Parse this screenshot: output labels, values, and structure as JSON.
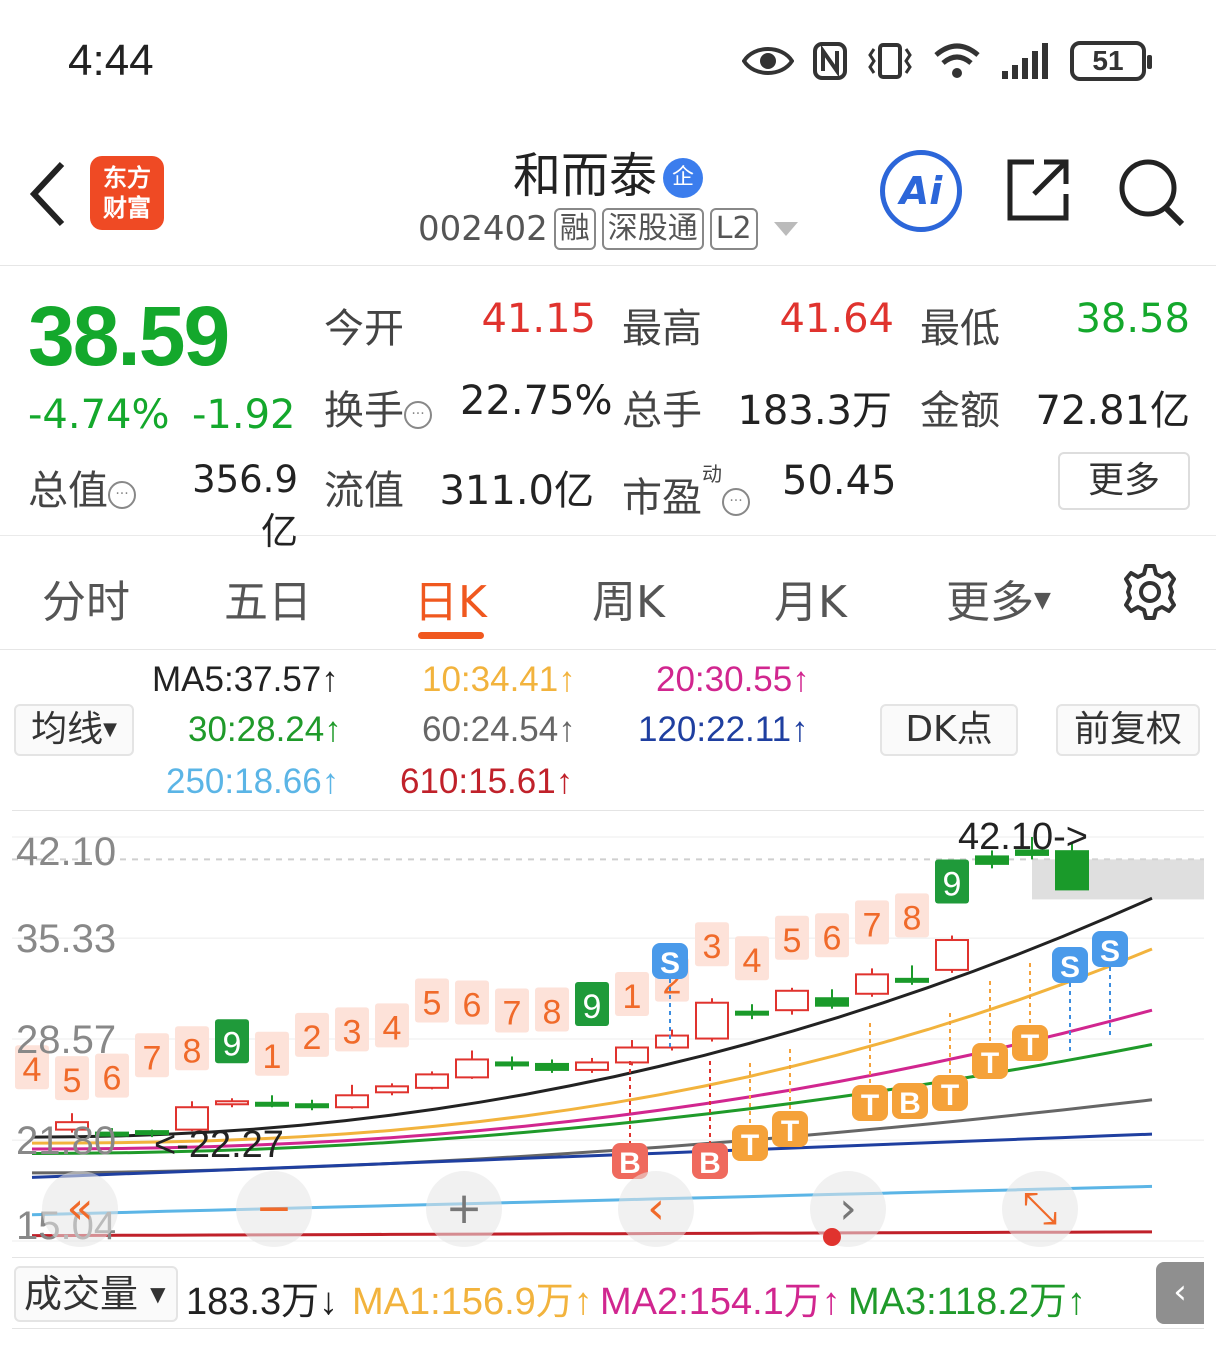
{
  "status": {
    "time": "4:44",
    "battery": "51"
  },
  "header": {
    "logo_line1": "东方",
    "logo_line2": "财富",
    "name": "和而泰",
    "badge": "企",
    "code": "002402",
    "tags": [
      "融",
      "深股通",
      "L2"
    ],
    "ai_label": "Ai"
  },
  "quote": {
    "price": "38.59",
    "change_pct": "-4.74%",
    "change_abs": "-1.92",
    "open_label": "今开",
    "open": "41.15",
    "high_label": "最高",
    "high": "41.64",
    "low_label": "最低",
    "low": "38.58",
    "turnover_label": "换手",
    "turnover": "22.75%",
    "volume_label": "总手",
    "volume": "183.3万",
    "amount_label": "金额",
    "amount": "72.81亿",
    "mcap_label": "总值",
    "mcap": "356.9亿",
    "float_label": "流值",
    "float": "311.0亿",
    "pe_label": "市盈",
    "pe_sup": "动",
    "pe": "50.45",
    "more": "更多"
  },
  "tabs": [
    "分时",
    "五日",
    "日K",
    "周K",
    "月K",
    "更多"
  ],
  "active_tab": "日K",
  "ma": {
    "selector": "均线",
    "items": [
      {
        "text": "MA5:37.57↑",
        "color": "#222222"
      },
      {
        "text": "10:34.41↑",
        "color": "#f2b33d"
      },
      {
        "text": "20:30.55↑",
        "color": "#d1268f"
      },
      {
        "text": "30:28.24↑",
        "color": "#1f9a2a"
      },
      {
        "text": "60:24.54↑",
        "color": "#666666"
      },
      {
        "text": "120:22.11↑",
        "color": "#1f3fa0"
      },
      {
        "text": "250:18.66↑",
        "color": "#5bb5e6"
      },
      {
        "text": "610:15.61↑",
        "color": "#c0212a"
      }
    ],
    "dk_button": "DK点",
    "adjust_button": "前复权"
  },
  "chart_data": {
    "type": "candlestick",
    "y_ticks": [
      "42.10",
      "35.33",
      "28.57",
      "21.80",
      "15.04"
    ],
    "ylim": [
      15.04,
      42.1
    ],
    "annotations": {
      "high": "42.10->",
      "low": "<-22.27"
    },
    "candles": [
      {
        "o": 22.5,
        "c": 23.0,
        "h": 23.6,
        "l": 22.3
      },
      {
        "o": 22.3,
        "c": 22.1,
        "h": 22.6,
        "l": 21.9
      },
      {
        "o": 22.4,
        "c": 22.2,
        "h": 22.5,
        "l": 22.0
      },
      {
        "o": 22.5,
        "c": 24.0,
        "h": 24.4,
        "l": 22.4
      },
      {
        "o": 24.2,
        "c": 24.4,
        "h": 24.6,
        "l": 24.0
      },
      {
        "o": 24.3,
        "c": 24.2,
        "h": 24.8,
        "l": 24.0
      },
      {
        "o": 24.2,
        "c": 24.0,
        "h": 24.5,
        "l": 23.8
      },
      {
        "o": 24.0,
        "c": 24.8,
        "h": 25.5,
        "l": 23.9
      },
      {
        "o": 25.0,
        "c": 25.4,
        "h": 25.6,
        "l": 24.8
      },
      {
        "o": 25.3,
        "c": 26.2,
        "h": 26.4,
        "l": 25.2
      },
      {
        "o": 26.0,
        "c": 27.2,
        "h": 27.8,
        "l": 25.9
      },
      {
        "o": 27.0,
        "c": 26.8,
        "h": 27.4,
        "l": 26.5
      },
      {
        "o": 26.9,
        "c": 26.5,
        "h": 27.2,
        "l": 26.3
      },
      {
        "o": 26.5,
        "c": 27.0,
        "h": 27.3,
        "l": 26.3
      },
      {
        "o": 27.0,
        "c": 28.0,
        "h": 28.5,
        "l": 26.8
      },
      {
        "o": 28.0,
        "c": 28.8,
        "h": 29.2,
        "l": 27.8
      },
      {
        "o": 28.6,
        "c": 31.0,
        "h": 31.3,
        "l": 28.4
      },
      {
        "o": 30.4,
        "c": 30.2,
        "h": 30.9,
        "l": 29.9
      },
      {
        "o": 30.5,
        "c": 31.8,
        "h": 32.0,
        "l": 30.2
      },
      {
        "o": 31.3,
        "c": 30.8,
        "h": 31.9,
        "l": 30.6
      },
      {
        "o": 31.6,
        "c": 32.9,
        "h": 33.3,
        "l": 31.4
      },
      {
        "o": 32.6,
        "c": 32.5,
        "h": 33.5,
        "l": 32.2
      },
      {
        "o": 33.2,
        "c": 35.2,
        "h": 35.5,
        "l": 33.0
      },
      {
        "o": 40.8,
        "c": 40.3,
        "h": 41.2,
        "l": 40.0
      },
      {
        "o": 41.2,
        "c": 40.9,
        "h": 42.1,
        "l": 40.6
      },
      {
        "o": 41.15,
        "c": 38.59,
        "h": 41.64,
        "l": 38.58
      }
    ],
    "signals": {
      "counts": [
        "4",
        "5",
        "6",
        "7",
        "8",
        "9",
        "1",
        "2",
        "3",
        "4",
        "5",
        "6",
        "7",
        "8",
        "9",
        "1",
        "2",
        "3",
        "4",
        "5",
        "6",
        "7",
        "8",
        "9"
      ],
      "buy_label": "B",
      "sell_label": "S",
      "t_label": "T"
    }
  },
  "chart_controls": {
    "fast_back": "«",
    "zoom_out": "−",
    "zoom_in": "+",
    "prev": "‹",
    "next": "›",
    "expand": "⤡"
  },
  "volume": {
    "selector": "成交量",
    "value": "183.3万↓",
    "ma1": "MA1:156.9万↑",
    "ma2": "MA2:154.1万↑",
    "ma3": "MA3:118.2万↑",
    "colors": {
      "value": "#222222",
      "ma1": "#f2b33d",
      "ma2": "#d1268f",
      "ma3": "#1f9a2a"
    },
    "side_tab": "‹"
  }
}
